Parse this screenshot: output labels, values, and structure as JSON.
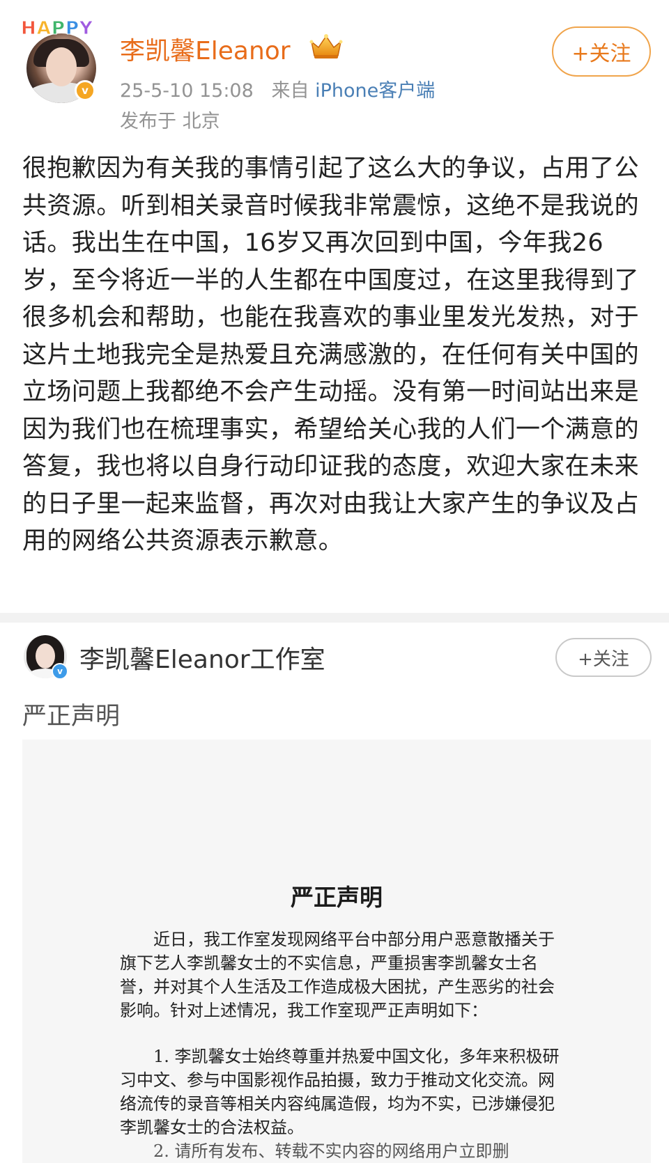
{
  "post1": {
    "happy_letters": [
      "H",
      "A",
      "P",
      "P",
      "Y"
    ],
    "username": "李凯馨Eleanor",
    "verified_badge": "v",
    "crown_icon": "vip-crown-icon",
    "timestamp": "25-5-10 15:08",
    "source_prefix": "来自",
    "source_client": "iPhone客户端",
    "location": "发布于 北京",
    "follow_label": "+关注",
    "body": "很抱歉因为有关我的事情引起了这么大的争议，占用了公共资源。听到相关录音时候我非常震惊，这绝不是我说的话。我出生在中国，16岁又再次回到中国，今年我26岁，至今将近一半的人生都在中国度过，在这里我得到了很多机会和帮助，也能在我喜欢的事业里发光发热，对于这片土地我完全是热爱且充满感激的，在任何有关中国的立场问题上我都绝不会产生动摇。没有第一时间站出来是因为我们也在梳理事实，希望给关心我的人们一个满意的答复，我也将以自身行动印证我的态度，欢迎大家在未来的日子里一起来监督，再次对由我让大家产生的争议及占用的网络公共资源表示歉意。"
  },
  "post2": {
    "username": "李凯馨Eleanor工作室",
    "verified_badge": "v",
    "follow_label": "+关注",
    "title": "严正声明",
    "document": {
      "heading": "严正声明",
      "intro": "近日，我工作室发现网络平台中部分用户恶意散播关于旗下艺人李凯馨女士的不实信息，严重损害李凯馨女士名誉，并对其个人生活及工作造成极大困扰，产生恶劣的社会影响。针对上述情况，我工作室现严正声明如下：",
      "item1": "1. 李凯馨女士始终尊重并热爱中国文化，多年来积极研习中文、参与中国影视作品拍摄，致力于推动文化交流。网络流传的录音等相关内容纯属造假，均为不实，已涉嫌侵犯李凯馨女士的合法权益。",
      "item2": "2. 请所有发布、转载不实内容的网络用户立即删"
    }
  }
}
